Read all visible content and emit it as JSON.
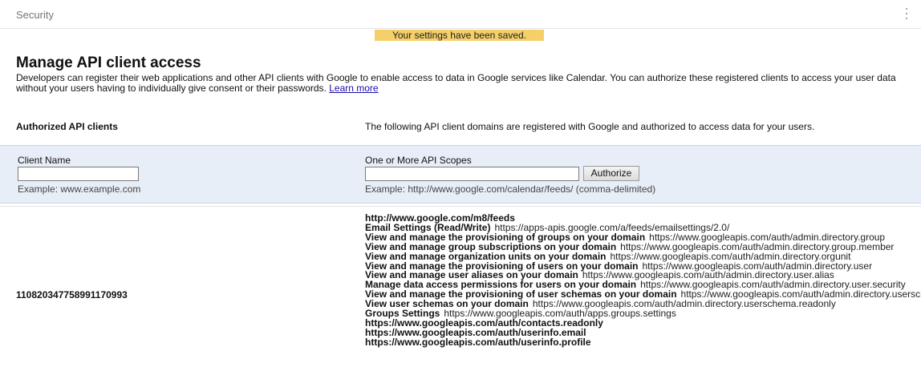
{
  "header": {
    "title": "Security",
    "menu_icon": "more-vert-icon"
  },
  "banner": {
    "message": "Your settings have been saved."
  },
  "page": {
    "title": "Manage API client access",
    "description": "Developers can register their web applications and other API clients with Google to enable access to data in Google services like Calendar. You can authorize these registered clients to access your user data without your users having to individually give consent or their passwords.",
    "learn_more": "Learn more"
  },
  "authorized": {
    "label": "Authorized API clients",
    "info": "The following API client domains are registered with Google and authorized to access data for your users."
  },
  "form": {
    "client_name_label": "Client Name",
    "client_name_value": "",
    "client_name_example": "Example: www.example.com",
    "scopes_label": "One or More API Scopes",
    "scopes_value": "",
    "scopes_example": "Example: http://www.google.com/calendar/feeds/ (comma-delimited)",
    "authorize_button": "Authorize"
  },
  "client": {
    "id": "110820347758991170993",
    "scopes": [
      {
        "name": "http://www.google.com/m8/feeds",
        "url": ""
      },
      {
        "name": "Email Settings (Read/Write)",
        "url": "https://apps-apis.google.com/a/feeds/emailsettings/2.0/"
      },
      {
        "name": "View and manage the provisioning of groups on your domain",
        "url": "https://www.googleapis.com/auth/admin.directory.group"
      },
      {
        "name": "View and manage group subscriptions on your domain",
        "url": "https://www.googleapis.com/auth/admin.directory.group.member"
      },
      {
        "name": "View and manage organization units on your domain",
        "url": "https://www.googleapis.com/auth/admin.directory.orgunit"
      },
      {
        "name": "View and manage the provisioning of users on your domain",
        "url": "https://www.googleapis.com/auth/admin.directory.user"
      },
      {
        "name": "View and manage user aliases on your domain",
        "url": "https://www.googleapis.com/auth/admin.directory.user.alias"
      },
      {
        "name": "Manage data access permissions for users on your domain",
        "url": "https://www.googleapis.com/auth/admin.directory.user.security"
      },
      {
        "name": "View and manage the provisioning of user schemas on your domain",
        "url": "https://www.googleapis.com/auth/admin.directory.userschema"
      },
      {
        "name": "View user schemas on your domain",
        "url": "https://www.googleapis.com/auth/admin.directory.userschema.readonly"
      },
      {
        "name": "Groups Settings",
        "url": "https://www.googleapis.com/auth/apps.groups.settings"
      },
      {
        "name": "https://www.googleapis.com/auth/contacts.readonly",
        "url": ""
      },
      {
        "name": "https://www.googleapis.com/auth/userinfo.email",
        "url": ""
      },
      {
        "name": "https://www.googleapis.com/auth/userinfo.profile",
        "url": ""
      }
    ]
  }
}
